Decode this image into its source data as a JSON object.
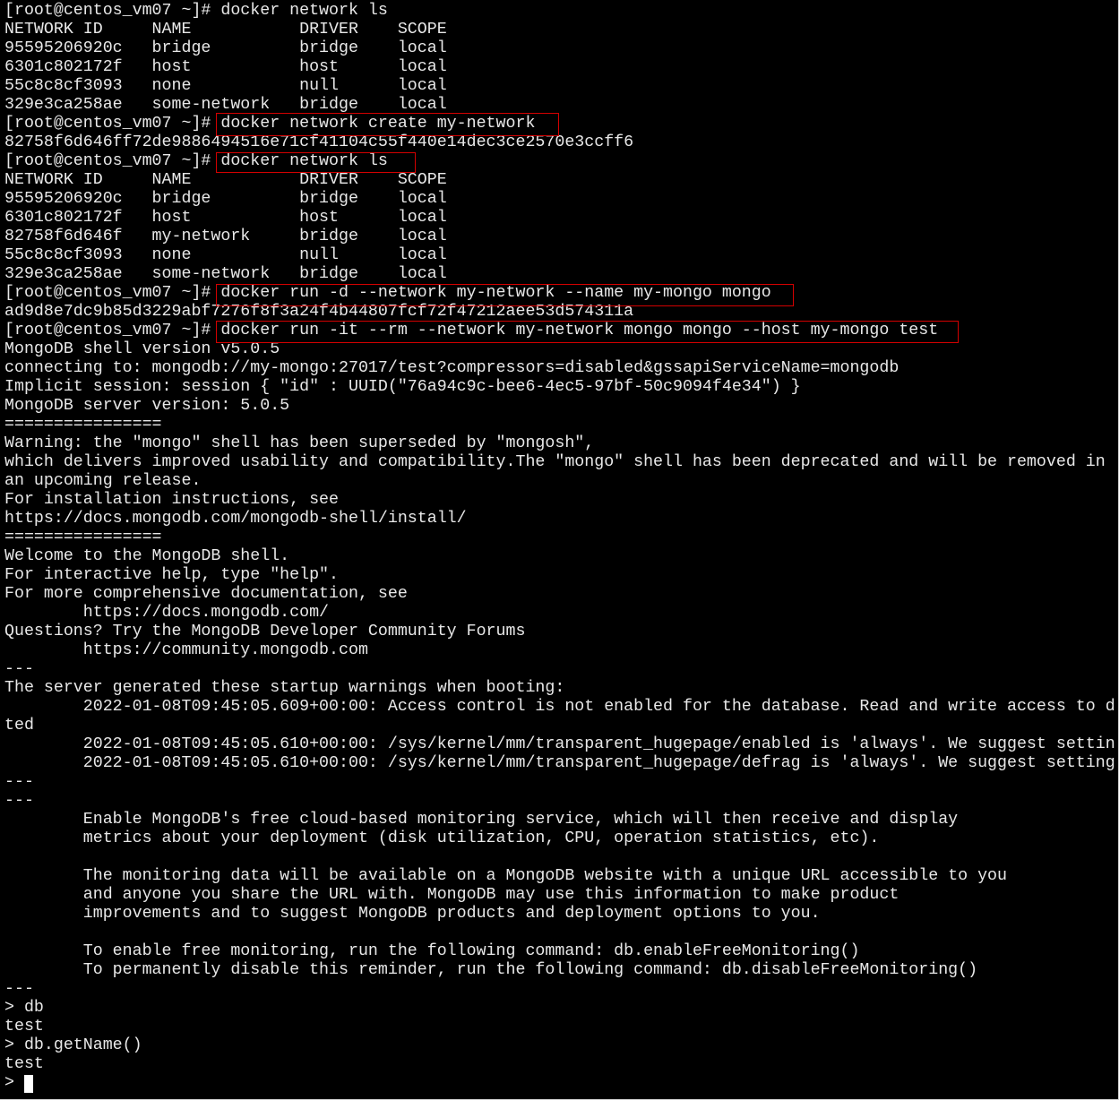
{
  "terminal": {
    "highlight_color": "#d40000",
    "text_color": "#e8e8e8",
    "background": "#000000",
    "lines": [
      "[root@centos_vm07 ~]# docker network ls",
      "NETWORK ID     NAME           DRIVER    SCOPE",
      "95595206920c   bridge         bridge    local",
      "6301c802172f   host           host      local",
      "55c8c8cf3093   none           null      local",
      "329e3ca258ae   some-network   bridge    local",
      "[root@centos_vm07 ~]# docker network create my-network",
      "82758f6d646ff72de9886494516e71cf41104c55f440e14dec3ce2570e3ccff6",
      "[root@centos_vm07 ~]# docker network ls",
      "NETWORK ID     NAME           DRIVER    SCOPE",
      "95595206920c   bridge         bridge    local",
      "6301c802172f   host           host      local",
      "82758f6d646f   my-network     bridge    local",
      "55c8c8cf3093   none           null      local",
      "329e3ca258ae   some-network   bridge    local",
      "[root@centos_vm07 ~]# docker run -d --network my-network --name my-mongo mongo",
      "ad9d8e7dc9b85d3229abf7276f8f3a24f4b44807fcf72f47212aee53d574311a",
      "[root@centos_vm07 ~]# docker run -it --rm --network my-network mongo mongo --host my-mongo test",
      "MongoDB shell version v5.0.5",
      "connecting to: mongodb://my-mongo:27017/test?compressors=disabled&gssapiServiceName=mongodb",
      "Implicit session: session { \"id\" : UUID(\"76a94c9c-bee6-4ec5-97bf-50c9094f4e34\") }",
      "MongoDB server version: 5.0.5",
      "================",
      "Warning: the \"mongo\" shell has been superseded by \"mongosh\",",
      "which delivers improved usability and compatibility.The \"mongo\" shell has been deprecated and will be removed in",
      "an upcoming release.",
      "For installation instructions, see",
      "https://docs.mongodb.com/mongodb-shell/install/",
      "================",
      "Welcome to the MongoDB shell.",
      "For interactive help, type \"help\".",
      "For more comprehensive documentation, see",
      "        https://docs.mongodb.com/",
      "Questions? Try the MongoDB Developer Community Forums",
      "        https://community.mongodb.com",
      "---",
      "The server generated these startup warnings when booting:",
      "        2022-01-08T09:45:05.609+00:00: Access control is not enabled for the database. Read and write access to d",
      "ted",
      "        2022-01-08T09:45:05.610+00:00: /sys/kernel/mm/transparent_hugepage/enabled is 'always'. We suggest settin",
      "        2022-01-08T09:45:05.610+00:00: /sys/kernel/mm/transparent_hugepage/defrag is 'always'. We suggest setting",
      "---",
      "---",
      "        Enable MongoDB's free cloud-based monitoring service, which will then receive and display",
      "        metrics about your deployment (disk utilization, CPU, operation statistics, etc).",
      "",
      "        The monitoring data will be available on a MongoDB website with a unique URL accessible to you",
      "        and anyone you share the URL with. MongoDB may use this information to make product",
      "        improvements and to suggest MongoDB products and deployment options to you.",
      "",
      "        To enable free monitoring, run the following command: db.enableFreeMonitoring()",
      "        To permanently disable this reminder, run the following command: db.disableFreeMonitoring()",
      "---",
      "> db",
      "test",
      "> db.getName()",
      "test",
      "> "
    ]
  }
}
